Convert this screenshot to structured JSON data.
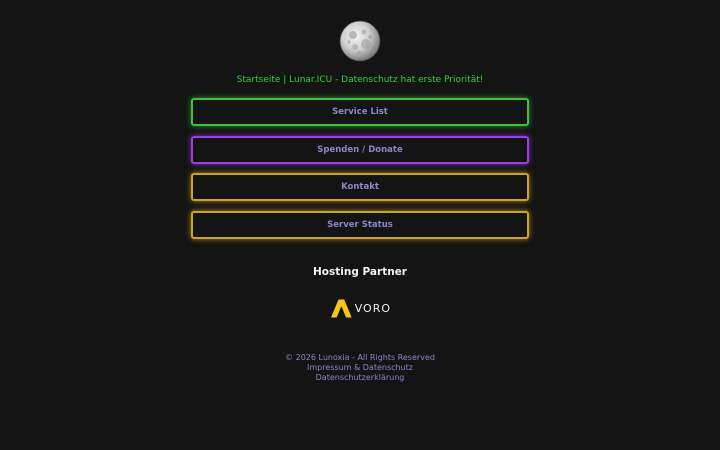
{
  "header": {
    "logo_icon": "moon-icon",
    "tagline": "Startseite | Lunar.ICU - Datenschutz hat erste Priorität!"
  },
  "nav": [
    {
      "label": "Service List",
      "border_color": "#3fbf3f",
      "glow": "#2e8f2e"
    },
    {
      "label": "Spenden / Donate",
      "border_color": "#9b3fe0",
      "glow": "#7a2fc4"
    },
    {
      "label": "Kontakt",
      "border_color": "#c9a227",
      "glow": "#a88318"
    },
    {
      "label": "Server Status",
      "border_color": "#c9a227",
      "glow": "#a88318"
    }
  ],
  "partner": {
    "title": "Hosting Partner",
    "logo_wordmark": "VORO",
    "logo_mark_color": "#f5c518"
  },
  "footer": {
    "copyright": "© 2026 Lunoxia - All Rights Reserved",
    "imprint_link": "Impressum & Datenschutz",
    "privacy_link": "Datenschutzerklärung"
  },
  "colors": {
    "background": "#141414",
    "tagline": "#2fd32f",
    "link_text": "#8a86c8",
    "heading": "#f2f2f2"
  }
}
